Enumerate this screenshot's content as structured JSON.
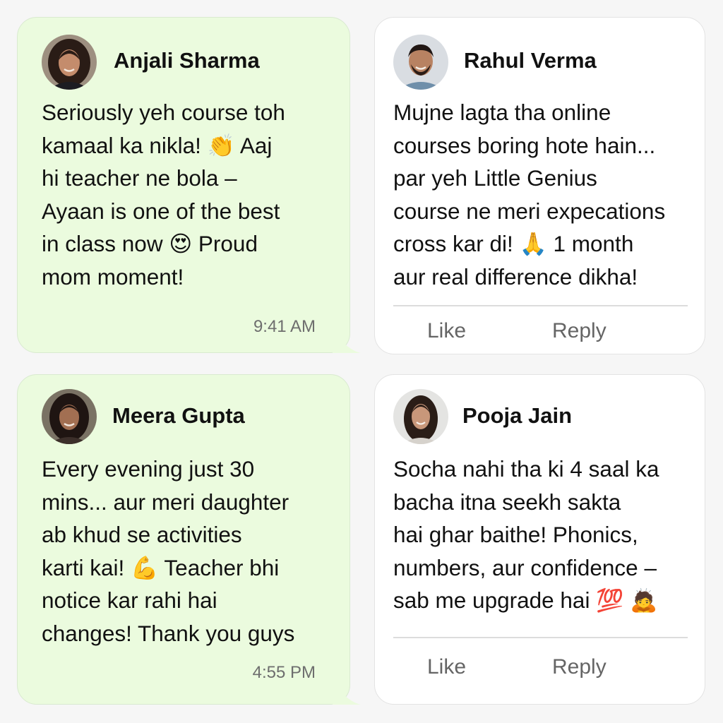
{
  "cards": {
    "anjali": {
      "name": "Anjali Sharma",
      "lines": [
        "Seriously yeh course toh",
        "kamaal ka nikla! 👏 Aaj",
        "hi teacher ne bola –",
        "Ayaan is one of the best",
        "in class now 😍 Proud",
        "mom moment!"
      ],
      "time": "9:41 AM"
    },
    "rahul": {
      "name": "Rahul Verma",
      "lines": [
        "Mujne lagta tha online",
        "courses boring hote hain...",
        "par yeh Little Genius",
        "course ne meri expecations",
        "cross kar di! 🙏 1 month",
        "aur real difference dikha!"
      ],
      "like": "Like",
      "reply": "Reply"
    },
    "meera": {
      "name": "Meera Gupta",
      "lines": [
        "Every evening just 30",
        "mins... aur meri daughter",
        "ab khud se activities",
        "karti kai! 💪 Teacher bhi",
        "notice kar rahi hai",
        "changes! Thank you guys"
      ],
      "time": "4:55 PM"
    },
    "pooja": {
      "name": "Pooja Jain",
      "lines": [
        "Socha nahi tha ki  4 saal ka",
        "bacha itna seekh sakta",
        "hai ghar baithe! Phonics,",
        "numbers, aur confidence –",
        "sab me upgrade hai 💯 🙇"
      ],
      "like": "Like",
      "reply": "Reply"
    }
  },
  "colors": {
    "whatsapp_bubble": "#ebfbde",
    "facebook_card": "#ffffff",
    "page_background": "#f6f6f6"
  }
}
